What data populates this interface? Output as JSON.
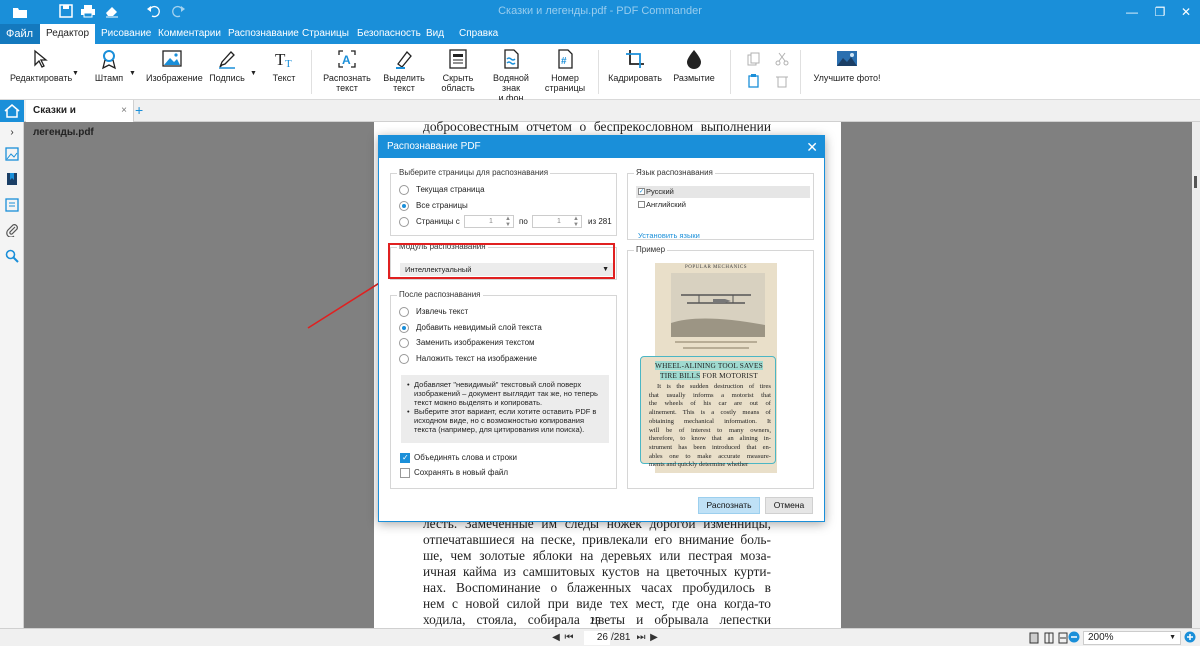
{
  "window": {
    "title": "Сказки и легенды.pdf - PDF Commander"
  },
  "menu": {
    "file_label": "Файл",
    "tabs": [
      "Редактор",
      "Рисование",
      "Комментарии",
      "Распознавание",
      "Страницы",
      "Безопасность",
      "Вид",
      "Справка"
    ],
    "active_tab": "Редактор"
  },
  "ribbon": {
    "edit": "Редактировать",
    "stamp": "Штамп",
    "image": "Изображение",
    "signature": "Подпись",
    "text": "Текст",
    "recognize_line1": "Распознать",
    "recognize_line2": "текст",
    "select_line1": "Выделить",
    "select_line2": "текст",
    "hide_line1": "Скрыть",
    "hide_line2": "область",
    "watermark_line1": "Водяной знак",
    "watermark_line2": "и фон",
    "pagenum_line1": "Номер",
    "pagenum_line2": "страницы",
    "crop": "Кадрировать",
    "blur": "Размытие",
    "enhance": "Улучшите фото!"
  },
  "tabs": {
    "document_name": "Сказки и легенды.pdf",
    "close": "×",
    "add": "+"
  },
  "document": {
    "top_line": "добросовестным отчетом о беспрекословном выполнении",
    "lines": [
      "лесть. Замеченные им следы ножек дорогой изменницы,",
      "отпечатавшиеся на песке, привлекали его внимание боль-",
      "ше, чем золотые яблоки на деревьях или пестрая моза-",
      "ичная кайма из самшитовых кустов на цветочных курти-",
      "нах. Воспоминание о блаженных часах пробудилось в",
      "нем с новой силой при виде тех мест, где она когда-то",
      "ходила, стояла, собирала цветы и обрывала лепестки"
    ],
    "page_number": "25"
  },
  "statusbar": {
    "current_page": "26",
    "total_pages": "/281",
    "zoom": "200%"
  },
  "dialog": {
    "title": "Распознавание PDF",
    "close": "✕",
    "pages_group": {
      "label": "Выберите страницы для распознавания",
      "current": "Текущая страница",
      "all": "Все страницы",
      "range": "Страницы с",
      "from_value": "1",
      "to_label": "по",
      "to_value": "1",
      "of_label": "из 281"
    },
    "module_group": {
      "label": "Модуль распознавания",
      "selected": "Интеллектуальный"
    },
    "after_group": {
      "label": "После распознавания",
      "extract": "Извлечь текст",
      "add_layer": "Добавить  невидимый слой текста",
      "replace": "Заменить изображения текстом",
      "overlay": "Наложить текст на изображение",
      "info": [
        "Добавляет \"невидимый\" текстовый слой поверх изображений – документ выглядит так же, но теперь текст можно выделять и копировать.",
        "Выберите этот вариант, если хотите оставить PDF в исходном виде, но с возможностью копирования текста (например, для цитирования или поиска)."
      ]
    },
    "merge_words": "Объединять слова и строки",
    "save_new": "Сохранять в новый файл",
    "language_group": {
      "label": "Язык распознавания",
      "russian": "Русский",
      "english": "Английский",
      "install": "Установить языки"
    },
    "sample_group": {
      "label": "Пример",
      "magazine_header": "POPULAR MECHANICS",
      "callout_title_1": "WHEEL-ALINING TOOL SAVES",
      "callout_title_2a": "TIRE BILLS",
      "callout_title_2b": " FOR MOTORIST",
      "callout_lines": [
        "It is the sudden destruction of tires",
        "that usually informs a motorist that",
        "the wheels of his car are out of",
        "alinement. This is a costly means of",
        "obtaining mechanical information. It",
        "will be of interest to many owners,",
        "therefore, to know that an alining in-",
        "strument has been introduced that en-",
        "ables one to make accurate measure-",
        "ments and quickly determine whether"
      ]
    },
    "recognize_btn": "Распознать",
    "cancel_btn": "Отмена"
  },
  "colors": {
    "accent": "#1a8fd9",
    "highlight": "#e02020"
  }
}
